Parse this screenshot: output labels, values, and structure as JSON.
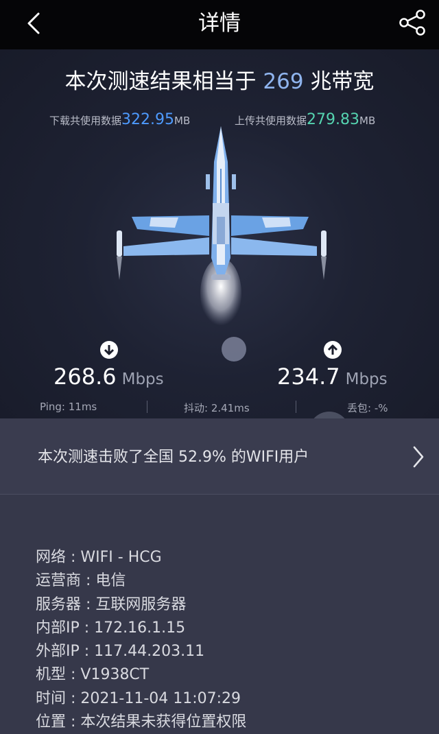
{
  "nav": {
    "title": "详情"
  },
  "hero": {
    "headline_prefix": "本次测速结果相当于",
    "headline_value": "269",
    "headline_suffix": "兆带宽",
    "download_usage": {
      "label": "下载共使用数据",
      "value": "322.95",
      "unit": "MB"
    },
    "upload_usage": {
      "label": "上传共使用数据",
      "value": "279.83",
      "unit": "MB"
    },
    "download_speed": {
      "value": "268.6",
      "unit": "Mbps"
    },
    "upload_speed": {
      "value": "234.7",
      "unit": "Mbps"
    },
    "ping": "Ping: 11ms",
    "jitter": "抖动: 2.41ms",
    "loss": "丢包: -%"
  },
  "rank": {
    "text": "本次测速击败了全国 52.9% 的WIFI用户"
  },
  "info": [
    {
      "text": "网络 : WIFI - HCG"
    },
    {
      "text": "运营商 : 电信"
    },
    {
      "text": "服务器 : 互联网服务器"
    },
    {
      "text": "内部IP : 172.16.1.15"
    },
    {
      "text": "外部IP : 117.44.203.11"
    },
    {
      "text": "机型 : V1938CT"
    },
    {
      "text": "时间 : 2021-11-04 11:07:29"
    },
    {
      "text": "位置 : 本次结果未获得位置权限"
    }
  ],
  "icons": {
    "back": "chevron-left-icon",
    "share": "share-icon",
    "download": "arrow-down-icon",
    "upload": "arrow-up-icon",
    "rank": "chevron-right-icon"
  },
  "colors": {
    "download_accent": "#4e9bff",
    "upload_accent": "#55d4b0",
    "headline_number": "#8fb4ee"
  }
}
